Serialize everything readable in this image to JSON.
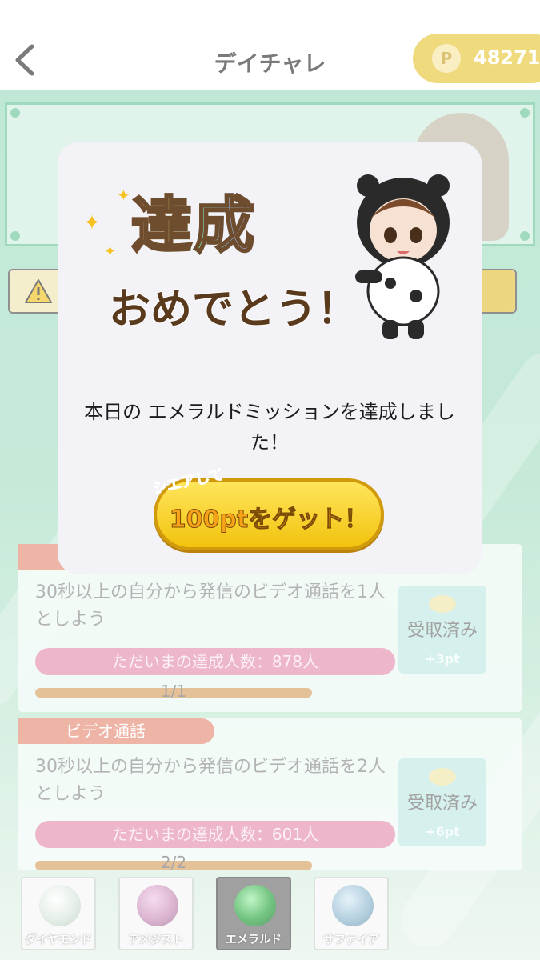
{
  "header": {
    "title": "デイチャレ",
    "points_icon": "P",
    "points_value": "48271"
  },
  "missions": [
    {
      "tag": "",
      "description": "30秒以上の自分から発信のビデオ通話を1人としよう",
      "achievers": "ただいまの達成人数：878人",
      "progress": "1/1",
      "progress_fraction": 1.0,
      "claim_label": "受取済み",
      "reward": "+3pt"
    },
    {
      "tag": "ビデオ通話",
      "description": "30秒以上の自分から発信のビデオ通話を2人としよう",
      "achievers": "ただいまの達成人数：601人",
      "progress": "2/2",
      "progress_fraction": 1.0,
      "claim_label": "受取済み",
      "reward": "+6pt"
    }
  ],
  "tabs": [
    {
      "label": "ダイヤモンド",
      "gem_color": "#d8e6dc"
    },
    {
      "label": "アメジスト",
      "gem_color": "#c98fb9"
    },
    {
      "label": "エメラルド",
      "gem_color": "#25a23c",
      "active": true
    },
    {
      "label": "サファイア",
      "gem_color": "#8fb7cf"
    }
  ],
  "modal": {
    "logo_main": "達成",
    "logo_sub": "おめでとう！",
    "message": "本日の エメラルドミッションを達成しました！",
    "share_prefix": "シエアして",
    "share_label": "100ptをゲット！"
  },
  "colors": {
    "accent_gold": "#e8c73a",
    "mission_tag": "#e58d77",
    "achievers_bar": "#e48fb0",
    "progress_bar": "#d8a060"
  }
}
